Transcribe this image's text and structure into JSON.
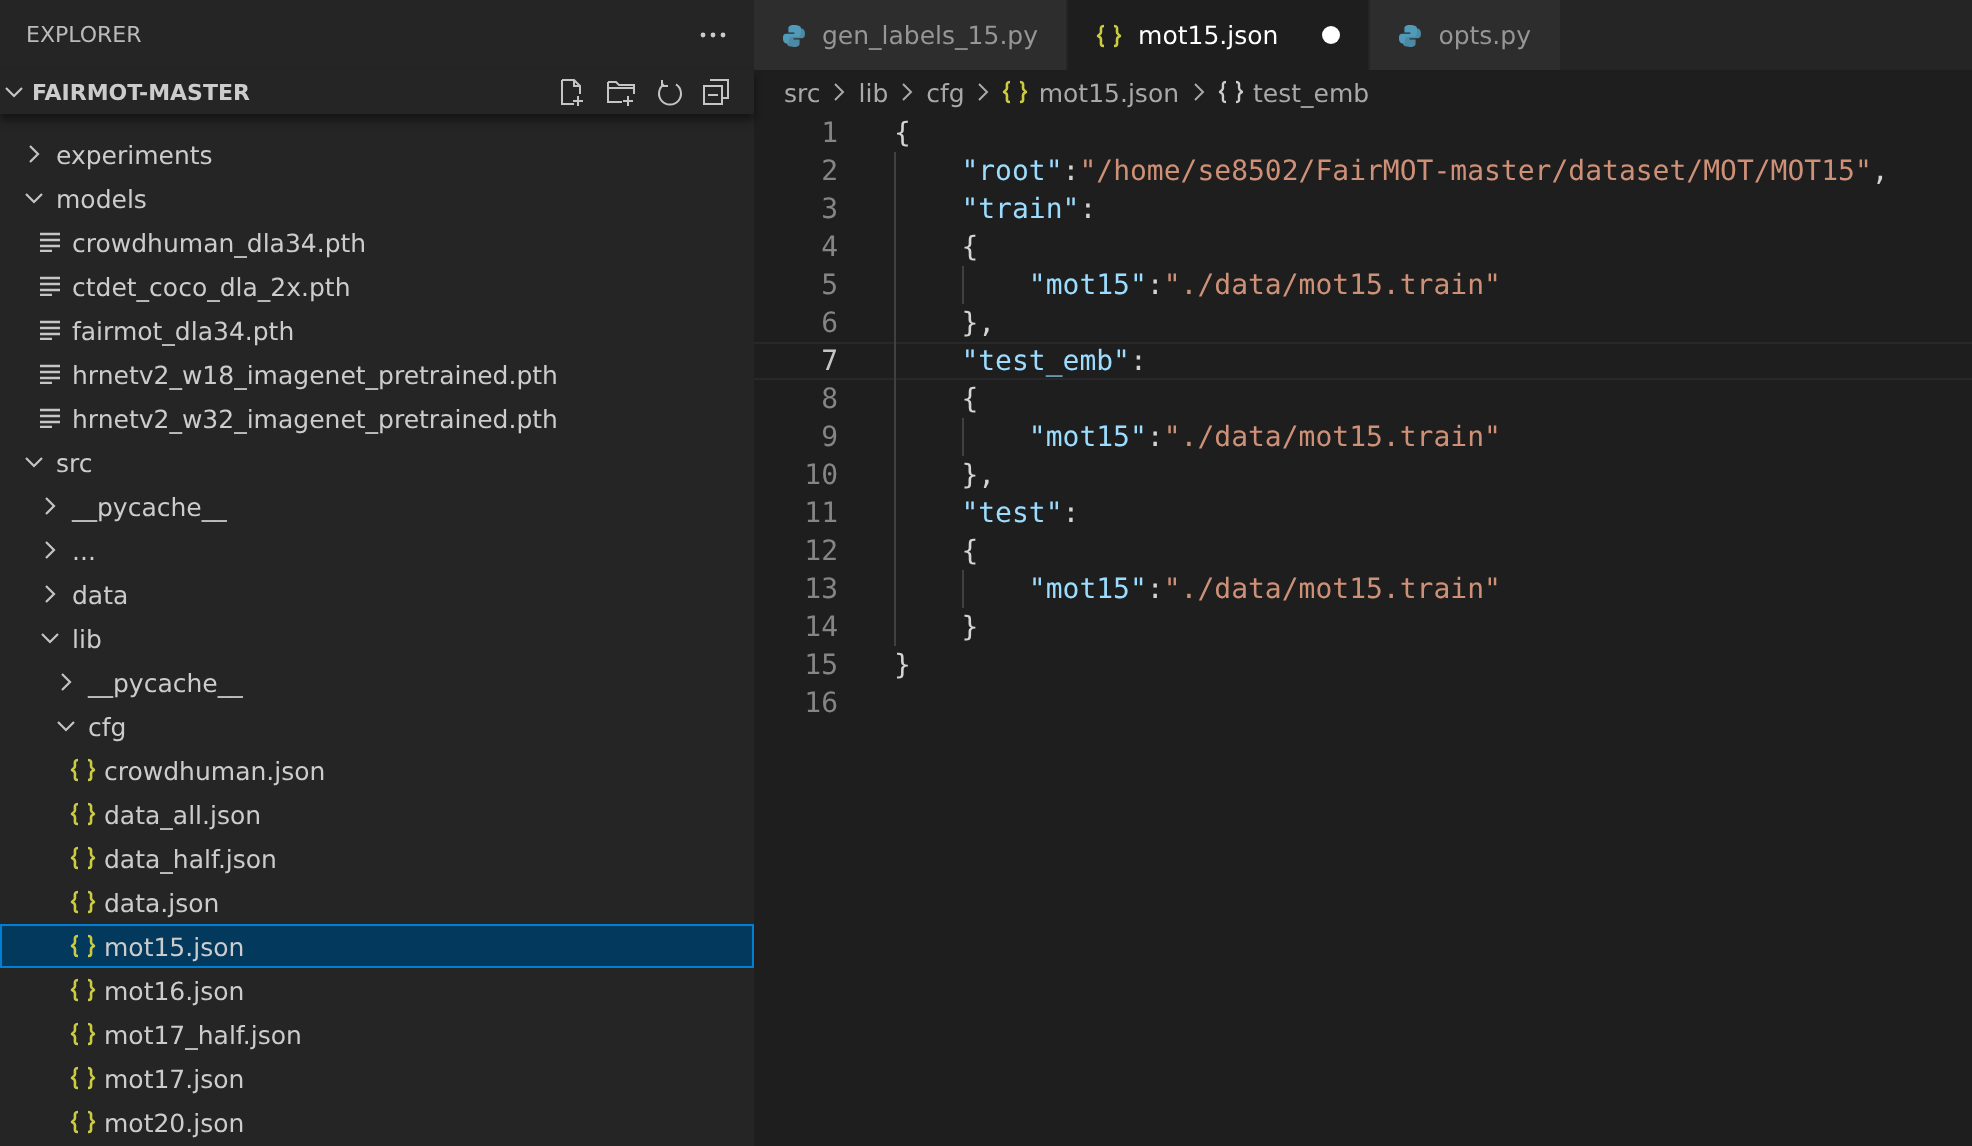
{
  "sidebar": {
    "title": "EXPLORER",
    "folder": {
      "name": "FAIRMOT-MASTER",
      "expanded": true
    },
    "tree": [
      {
        "name": "experiments",
        "kind": "folder",
        "expanded": false,
        "selected": false
      },
      {
        "name": "models",
        "kind": "folder",
        "expanded": true,
        "selected": false,
        "children": [
          {
            "name": "crowdhuman_dla34.pth",
            "kind": "file",
            "selected": false
          },
          {
            "name": "ctdet_coco_dla_2x.pth",
            "kind": "file",
            "selected": false
          },
          {
            "name": "fairmot_dla34.pth",
            "kind": "file",
            "selected": false
          },
          {
            "name": "hrnetv2_w18_imagenet_pretrained.pth",
            "kind": "file",
            "selected": false
          },
          {
            "name": "hrnetv2_w32_imagenet_pretrained.pth",
            "kind": "file",
            "selected": false
          }
        ]
      },
      {
        "name": "src",
        "kind": "folder",
        "expanded": true,
        "selected": false,
        "children": [
          {
            "name": "__pycache__",
            "kind": "folder",
            "expanded": false,
            "selected": false
          },
          {
            "name": "...",
            "kind": "folder",
            "expanded": false,
            "selected": false
          },
          {
            "name": "data",
            "kind": "folder",
            "expanded": false,
            "selected": false
          },
          {
            "name": "lib",
            "kind": "folder",
            "expanded": true,
            "selected": false,
            "children": [
              {
                "name": "__pycache__",
                "kind": "folder",
                "expanded": false,
                "selected": false
              },
              {
                "name": "cfg",
                "kind": "folder",
                "expanded": true,
                "selected": false,
                "children": [
                  {
                    "name": "crowdhuman.json",
                    "kind": "json",
                    "selected": false
                  },
                  {
                    "name": "data_all.json",
                    "kind": "json",
                    "selected": false
                  },
                  {
                    "name": "data_half.json",
                    "kind": "json",
                    "selected": false
                  },
                  {
                    "name": "data.json",
                    "kind": "json",
                    "selected": false
                  },
                  {
                    "name": "mot15.json",
                    "kind": "json",
                    "selected": true
                  },
                  {
                    "name": "mot16.json",
                    "kind": "json",
                    "selected": false
                  },
                  {
                    "name": "mot17_half.json",
                    "kind": "json",
                    "selected": false
                  },
                  {
                    "name": "mot17.json",
                    "kind": "json",
                    "selected": false
                  },
                  {
                    "name": "mot20.json",
                    "kind": "json",
                    "selected": false
                  }
                ]
              }
            ]
          }
        ]
      }
    ]
  },
  "tabs": [
    {
      "label": "gen_labels_15.py",
      "kind": "python",
      "selected": false,
      "modified": false
    },
    {
      "label": "mot15.json",
      "kind": "json",
      "selected": true,
      "modified": true
    },
    {
      "label": "opts.py",
      "kind": "python",
      "selected": false,
      "modified": false
    }
  ],
  "breadcrumb": [
    {
      "label": "src",
      "kind": "plain"
    },
    {
      "label": "lib",
      "kind": "plain"
    },
    {
      "label": "cfg",
      "kind": "plain"
    },
    {
      "label": "mot15.json",
      "kind": "json"
    },
    {
      "label": "test_emb",
      "kind": "object"
    }
  ],
  "editor": {
    "lines": [
      {
        "number": "1",
        "current": false,
        "tokens": [
          {
            "kind": "punct",
            "text": "{"
          }
        ]
      },
      {
        "number": "2",
        "current": false,
        "tokens": [
          {
            "kind": "indent"
          },
          {
            "kind": "key",
            "text": "\"root\""
          },
          {
            "kind": "punct",
            "text": ":"
          },
          {
            "kind": "string",
            "text": "\"/home/se8502/FairMOT-master/dataset/MOT/MOT15\""
          },
          {
            "kind": "punct",
            "text": ","
          }
        ]
      },
      {
        "number": "3",
        "current": false,
        "tokens": [
          {
            "kind": "indent"
          },
          {
            "kind": "key",
            "text": "\"train\""
          },
          {
            "kind": "punct",
            "text": ":"
          }
        ]
      },
      {
        "number": "4",
        "current": false,
        "tokens": [
          {
            "kind": "indent"
          },
          {
            "kind": "punct",
            "text": "{"
          }
        ]
      },
      {
        "number": "5",
        "current": false,
        "tokens": [
          {
            "kind": "indent"
          },
          {
            "kind": "indent"
          },
          {
            "kind": "key",
            "text": "\"mot15\""
          },
          {
            "kind": "punct",
            "text": ":"
          },
          {
            "kind": "string",
            "text": "\"./data/mot15.train\""
          }
        ]
      },
      {
        "number": "6",
        "current": false,
        "tokens": [
          {
            "kind": "indent"
          },
          {
            "kind": "punct",
            "text": "},"
          }
        ]
      },
      {
        "number": "7",
        "current": true,
        "tokens": [
          {
            "kind": "indent"
          },
          {
            "kind": "key",
            "text": "\"test_emb\""
          },
          {
            "kind": "punct",
            "text": ":"
          }
        ]
      },
      {
        "number": "8",
        "current": false,
        "tokens": [
          {
            "kind": "indent"
          },
          {
            "kind": "punct",
            "text": "{"
          }
        ]
      },
      {
        "number": "9",
        "current": false,
        "tokens": [
          {
            "kind": "indent"
          },
          {
            "kind": "indent"
          },
          {
            "kind": "key",
            "text": "\"mot15\""
          },
          {
            "kind": "punct",
            "text": ":"
          },
          {
            "kind": "string",
            "text": "\"./data/mot15.train\""
          }
        ]
      },
      {
        "number": "10",
        "current": false,
        "tokens": [
          {
            "kind": "indent"
          },
          {
            "kind": "punct",
            "text": "},"
          }
        ]
      },
      {
        "number": "11",
        "current": false,
        "tokens": [
          {
            "kind": "indent"
          },
          {
            "kind": "key",
            "text": "\"test\""
          },
          {
            "kind": "punct",
            "text": ":"
          }
        ]
      },
      {
        "number": "12",
        "current": false,
        "tokens": [
          {
            "kind": "indent"
          },
          {
            "kind": "punct",
            "text": "{"
          }
        ]
      },
      {
        "number": "13",
        "current": false,
        "tokens": [
          {
            "kind": "indent"
          },
          {
            "kind": "indent"
          },
          {
            "kind": "key",
            "text": "\"mot15\""
          },
          {
            "kind": "punct",
            "text": ":"
          },
          {
            "kind": "string",
            "text": "\"./data/mot15.train\""
          }
        ]
      },
      {
        "number": "14",
        "current": false,
        "tokens": [
          {
            "kind": "indent"
          },
          {
            "kind": "punct",
            "text": "}"
          }
        ]
      },
      {
        "number": "15",
        "current": false,
        "tokens": [
          {
            "kind": "punct",
            "text": "}"
          }
        ]
      },
      {
        "number": "16",
        "current": false
      }
    ]
  }
}
